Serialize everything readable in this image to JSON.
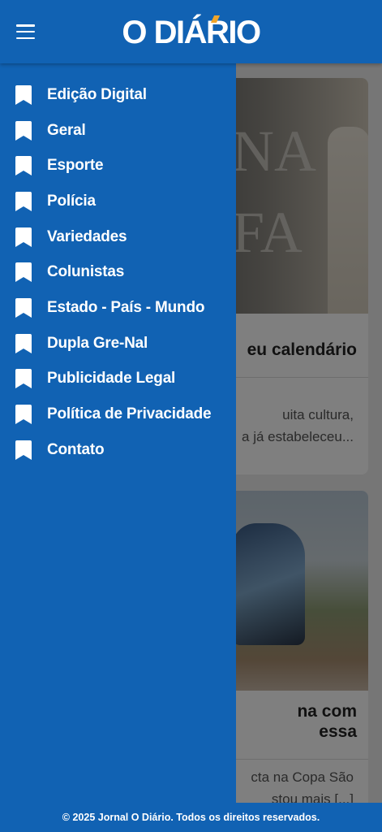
{
  "header": {
    "logo": "O DIÁRIO"
  },
  "menu": {
    "items": [
      {
        "label": "Edição Digital"
      },
      {
        "label": "Geral"
      },
      {
        "label": "Esporte"
      },
      {
        "label": "Polícia"
      },
      {
        "label": "Variedades"
      },
      {
        "label": "Colunistas"
      },
      {
        "label": "Estado - País - Mundo"
      },
      {
        "label": "Dupla Gre-Nal"
      },
      {
        "label": "Publicidade Legal"
      },
      {
        "label": "Política de Privacidade"
      },
      {
        "label": "Contato"
      }
    ]
  },
  "articles": [
    {
      "title": "eu calendário",
      "excerpt_1": "uita cultura,",
      "excerpt_2": "a já estabeleceu..."
    },
    {
      "title_1": "na com",
      "title_2": "essa",
      "excerpt_1": "cta na Copa São",
      "excerpt_2": "stou mais [...]"
    }
  ],
  "footer": {
    "text": "© 2025 Jornal O Diário. Todos os direitos reservados."
  },
  "colors": {
    "brand": "#1162b3",
    "accent": "#f0a52a"
  }
}
